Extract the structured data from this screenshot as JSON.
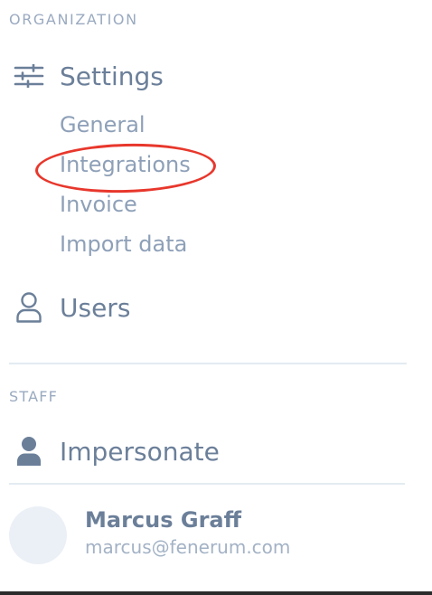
{
  "organization": {
    "section_label": "ORGANIZATION",
    "settings": {
      "label": "Settings",
      "icon": "sliders-icon",
      "sub_items": [
        {
          "label": "General"
        },
        {
          "label": "Integrations",
          "highlighted": true
        },
        {
          "label": "Invoice"
        },
        {
          "label": "Import data"
        }
      ]
    },
    "users": {
      "label": "Users",
      "icon": "user-outline-icon"
    }
  },
  "staff": {
    "section_label": "STAFF",
    "impersonate": {
      "label": "Impersonate",
      "icon": "user-solid-icon"
    }
  },
  "current_user": {
    "name": "Marcus Graff",
    "email": "marcus@fenerum.com"
  },
  "colors": {
    "text_primary": "#6b7f99",
    "text_sub": "#8ea0b8",
    "section_label": "#9aaac0",
    "annotation": "#e8372c",
    "avatar_bg": "#ebf0f7"
  }
}
